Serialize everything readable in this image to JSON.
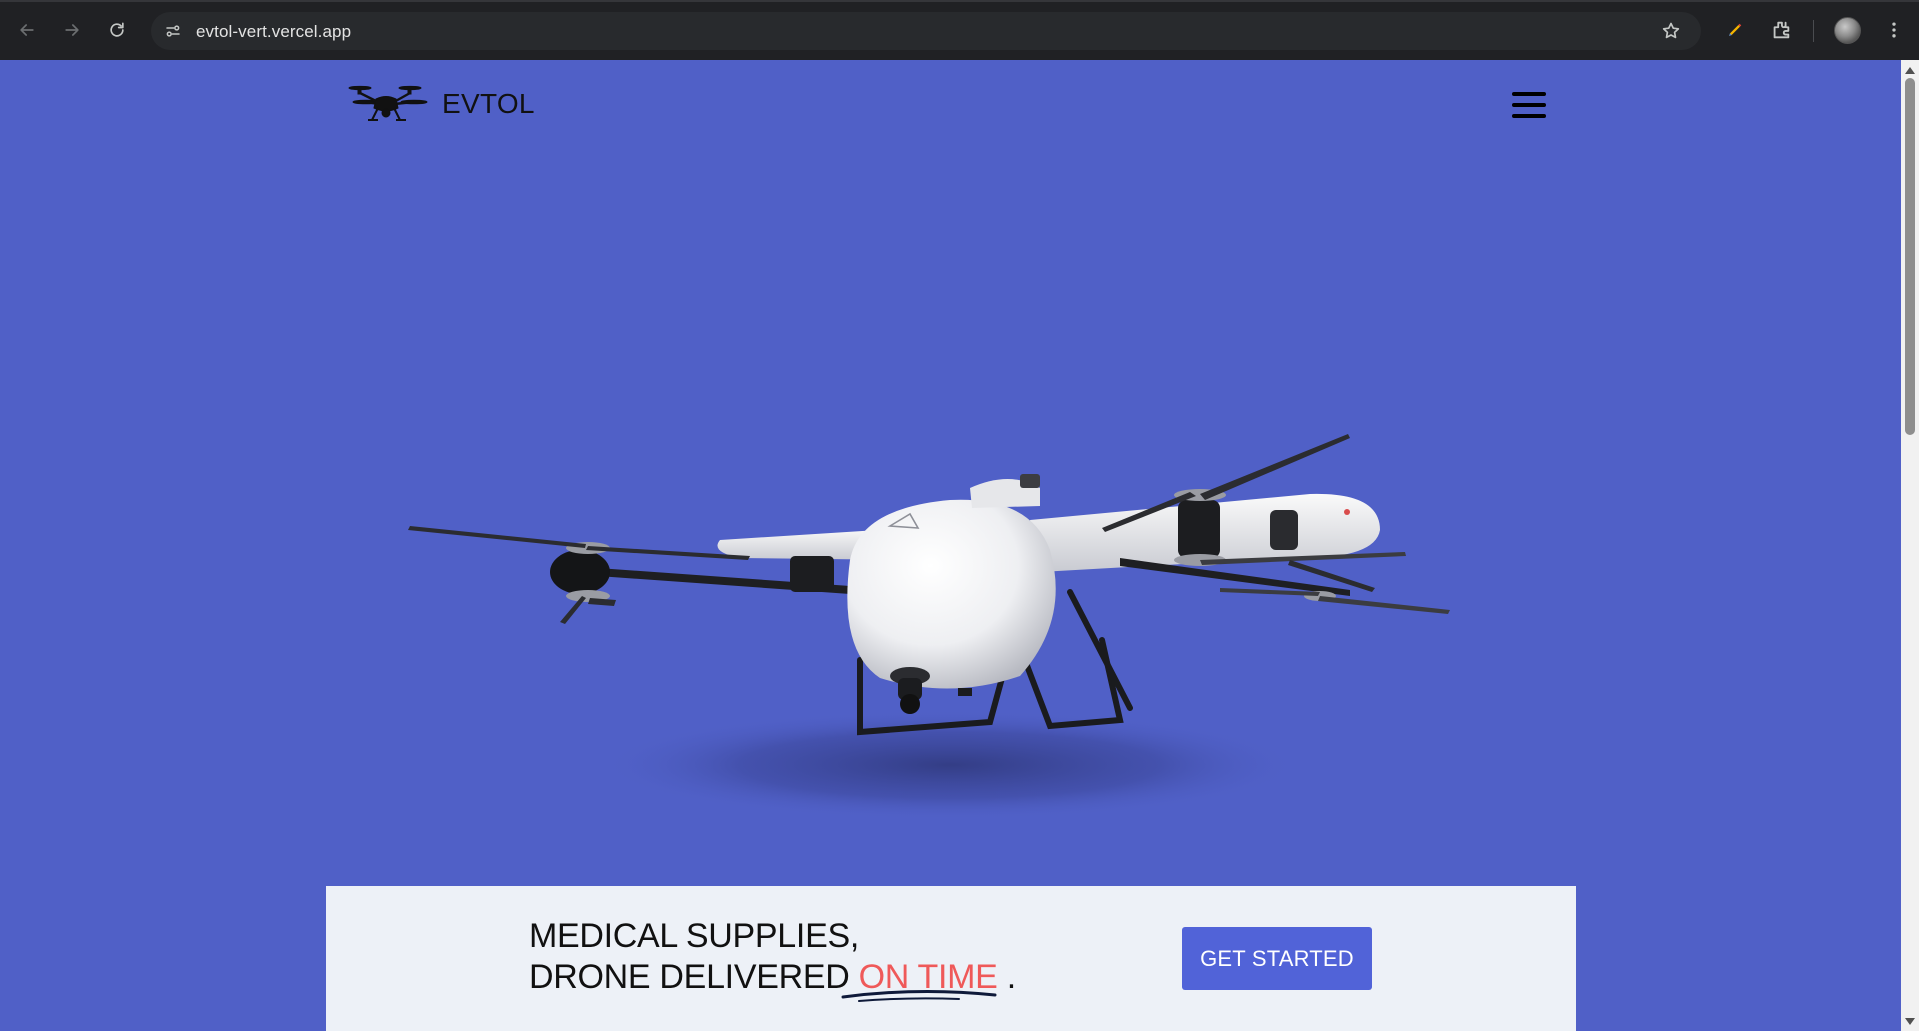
{
  "browser": {
    "url": "evtol-vert.vercel.app",
    "icons": [
      "back-icon",
      "forward-icon",
      "reload-icon",
      "site-settings-icon",
      "star-icon",
      "pen-icon",
      "extensions-icon",
      "avatar",
      "more-icon"
    ]
  },
  "header": {
    "brand": "EVTOL",
    "logo_icon": "drone-icon",
    "menu_icon": "hamburger-icon"
  },
  "hero": {
    "image_subject": "vtol-drone"
  },
  "cta": {
    "line1": "MEDICAL SUPPLIES,",
    "line2_prefix": "DRONE DELIVERED ",
    "line2_accent": "ON TIME",
    "line2_suffix": " .",
    "button_label": "GET STARTED"
  },
  "colors": {
    "page_background": "#5060c7",
    "card_background": "#edf1f7",
    "accent_red": "#ef5959",
    "button_blue": "#5163d8"
  }
}
